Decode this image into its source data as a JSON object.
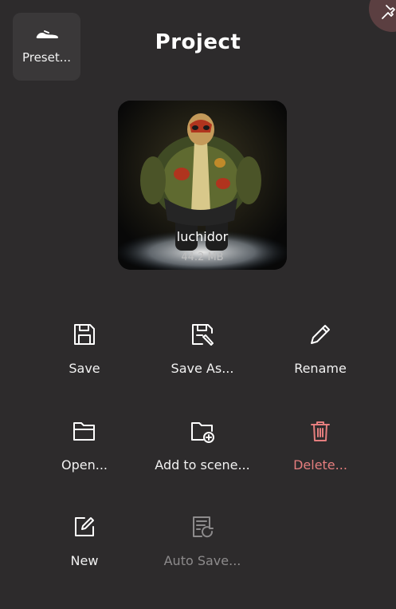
{
  "header": {
    "title": "Project",
    "preset_label": "Preset..."
  },
  "project": {
    "name": "luchidor",
    "size": "44.2 MB"
  },
  "actions": [
    {
      "label": "Save",
      "icon": "save-icon"
    },
    {
      "label": "Save As...",
      "icon": "save-as-icon"
    },
    {
      "label": "Rename",
      "icon": "pencil-icon"
    },
    {
      "label": "Open...",
      "icon": "folder-icon"
    },
    {
      "label": "Add to scene...",
      "icon": "folder-add-icon"
    },
    {
      "label": "Delete...",
      "icon": "trash-icon"
    },
    {
      "label": "New",
      "icon": "new-document-icon"
    },
    {
      "label": "Auto Save...",
      "icon": "auto-save-icon"
    }
  ],
  "colors": {
    "background": "#2d2b2c",
    "button": "#3a3839",
    "danger": "#e57e7e",
    "disabled": "#8d8b8c",
    "pin": "#5b3f41"
  }
}
